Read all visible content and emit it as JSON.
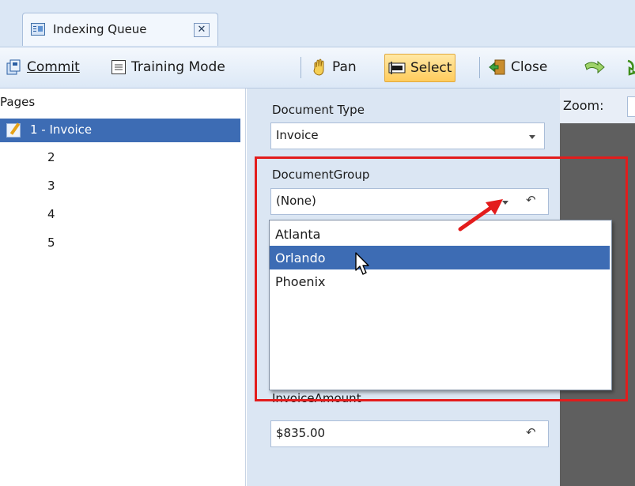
{
  "tab": {
    "label": "Indexing Queue",
    "close_symbol": "✕"
  },
  "toolbar": {
    "commit_label": "Commit",
    "training_mode_label": "Training Mode",
    "pan_label": "Pan",
    "select_label": "Select",
    "close_label": "Close"
  },
  "pages": {
    "title": "Pages",
    "items": [
      {
        "label": "1 - Invoice",
        "selected": true
      },
      {
        "label": "2"
      },
      {
        "label": "3"
      },
      {
        "label": "4"
      },
      {
        "label": "5"
      }
    ]
  },
  "form": {
    "document_type": {
      "label": "Document Type",
      "value": "Invoice"
    },
    "document_group": {
      "label": "DocumentGroup",
      "value": "(None)",
      "options": [
        "Atlanta",
        "Orlando",
        "Phoenix"
      ],
      "highlighted_option": "Orlando"
    },
    "invoice_amount": {
      "label": "InvoiceAmount",
      "value": "$835.00"
    },
    "undo_symbol": "↶"
  },
  "zoom": {
    "label": "Zoom:"
  },
  "colors": {
    "selection": "#3d6cb4",
    "annotation": "#e31c1c",
    "toolbar_bg": "#dce8f6",
    "form_bg": "#dbe6f3",
    "viewer_bg": "#5f5f5f"
  },
  "icons": [
    "indexing-queue-icon",
    "commit-icon",
    "training-mode-icon",
    "pan-hand-icon",
    "select-icon",
    "close-door-icon",
    "arrow-icon",
    "page-edit-icon",
    "dropdown-arrow-icon",
    "undo-icon",
    "mouse-cursor-icon"
  ]
}
